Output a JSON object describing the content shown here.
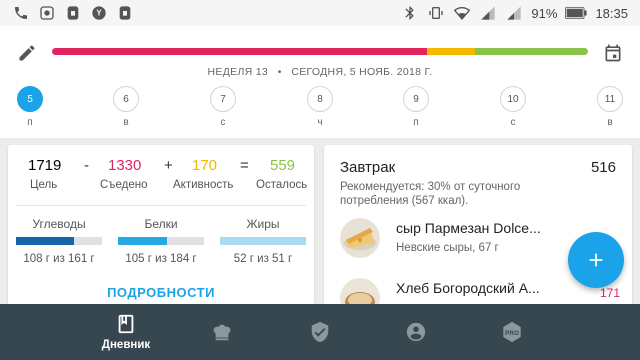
{
  "status_bar": {
    "battery_percent": "91%",
    "time": "18:35",
    "icons": [
      "phone-wifi-icon",
      "app-icon",
      "lock-icon",
      "yandex-icon",
      "lock-icon",
      "bluetooth-icon",
      "vibrate-icon",
      "wifi-icon",
      "signal-icon",
      "signal-icon",
      "battery-icon"
    ]
  },
  "header": {
    "edit_icon": "pencil-icon",
    "calendar_icon": "calendar-icon",
    "progress_segments": [
      {
        "name": "eaten",
        "fraction": 0.7,
        "color": "#e0245e"
      },
      {
        "name": "activity",
        "fraction": 0.09,
        "color": "#f5b800"
      },
      {
        "name": "remaining",
        "fraction": 0.21,
        "color": "#8bc34a"
      }
    ],
    "week_label": "НЕДЕЛЯ 13",
    "separator": "•",
    "date_label": "СЕГОДНЯ, 5 НОЯБ. 2018 Г."
  },
  "days": [
    {
      "num": "5",
      "label": "п",
      "active": true
    },
    {
      "num": "6",
      "label": "в",
      "active": false
    },
    {
      "num": "7",
      "label": "с",
      "active": false
    },
    {
      "num": "8",
      "label": "ч",
      "active": false
    },
    {
      "num": "9",
      "label": "п",
      "active": false
    },
    {
      "num": "10",
      "label": "с",
      "active": false
    },
    {
      "num": "11",
      "label": "в",
      "active": false
    }
  ],
  "summary": {
    "goal": {
      "value": "1719",
      "label": "Цель",
      "color": "#222222"
    },
    "minus": "-",
    "eaten": {
      "value": "1330",
      "label": "Съедено",
      "color": "#e0245e"
    },
    "plus": "+",
    "activity": {
      "value": "170",
      "label": "Активность",
      "color": "#f5b800"
    },
    "equals": "=",
    "remaining": {
      "value": "559",
      "label": "Осталось",
      "color": "#8bc34a"
    }
  },
  "macros": [
    {
      "name": "Углеводы",
      "value": "108 г из 161 г",
      "fill": 0.67,
      "color": "#1565a8"
    },
    {
      "name": "Белки",
      "value": "105 г из 184 г",
      "fill": 0.57,
      "color": "#29a8e6"
    },
    {
      "name": "Жиры",
      "value": "52 г из 51 г",
      "fill": 1.0,
      "color": "#a9dcf3"
    }
  ],
  "details_button": "ПОДРОБНОСТИ",
  "meal": {
    "title": "Завтрак",
    "kcal": "516",
    "recommendation": "Рекомендуется: 30% от суточного потребления (567 ккал).",
    "items": [
      {
        "name": "сыр Пармезан Dolce...",
        "sub": "Невские сыры, 67 г",
        "kcal": "",
        "thumb": "cheese-photo"
      },
      {
        "name": "Хлеб Богородский А...",
        "sub": "",
        "kcal": "171",
        "thumb": "bread-photo"
      }
    ]
  },
  "fab_icon": "plus-icon",
  "bottom_nav": [
    {
      "icon": "diary-icon",
      "label": "Дневник",
      "active": true
    },
    {
      "icon": "chef-hat-icon",
      "label": "",
      "active": false
    },
    {
      "icon": "shield-check-icon",
      "label": "",
      "active": false
    },
    {
      "icon": "account-icon",
      "label": "",
      "active": false
    },
    {
      "icon": "pro-icon",
      "label": "",
      "active": false
    }
  ]
}
